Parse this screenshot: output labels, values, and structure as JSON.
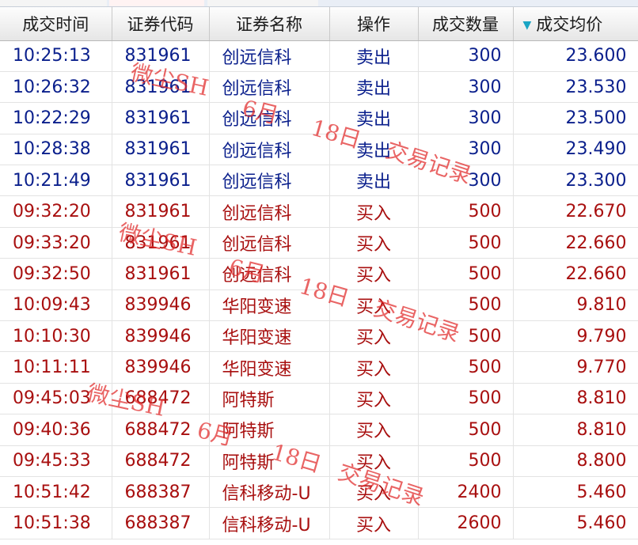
{
  "columns": [
    "成交时间",
    "证券代码",
    "证券名称",
    "操作",
    "成交数量",
    "成交均价"
  ],
  "sort_column": "成交均价",
  "rows": [
    {
      "time": "10:25:13",
      "code": "831961",
      "name": "创远信科",
      "op": "卖出",
      "qty": "300",
      "price": "23.600",
      "type": "sell"
    },
    {
      "time": "10:26:32",
      "code": "831961",
      "name": "创远信科",
      "op": "卖出",
      "qty": "300",
      "price": "23.530",
      "type": "sell"
    },
    {
      "time": "10:22:29",
      "code": "831961",
      "name": "创远信科",
      "op": "卖出",
      "qty": "300",
      "price": "23.500",
      "type": "sell"
    },
    {
      "time": "10:28:38",
      "code": "831961",
      "name": "创远信科",
      "op": "卖出",
      "qty": "300",
      "price": "23.490",
      "type": "sell"
    },
    {
      "time": "10:21:49",
      "code": "831961",
      "name": "创远信科",
      "op": "卖出",
      "qty": "300",
      "price": "23.300",
      "type": "sell"
    },
    {
      "time": "09:32:20",
      "code": "831961",
      "name": "创远信科",
      "op": "买入",
      "qty": "500",
      "price": "22.670",
      "type": "buy"
    },
    {
      "time": "09:33:20",
      "code": "831961",
      "name": "创远信科",
      "op": "买入",
      "qty": "500",
      "price": "22.660",
      "type": "buy"
    },
    {
      "time": "09:32:50",
      "code": "831961",
      "name": "创远信科",
      "op": "买入",
      "qty": "500",
      "price": "22.660",
      "type": "buy"
    },
    {
      "time": "10:09:43",
      "code": "839946",
      "name": "华阳变速",
      "op": "买入",
      "qty": "500",
      "price": "9.810",
      "type": "buy"
    },
    {
      "time": "10:10:30",
      "code": "839946",
      "name": "华阳变速",
      "op": "买入",
      "qty": "500",
      "price": "9.790",
      "type": "buy"
    },
    {
      "time": "10:11:11",
      "code": "839946",
      "name": "华阳变速",
      "op": "买入",
      "qty": "500",
      "price": "9.770",
      "type": "buy"
    },
    {
      "time": "09:45:03",
      "code": "688472",
      "name": "阿特斯",
      "op": "买入",
      "qty": "500",
      "price": "8.810",
      "type": "buy"
    },
    {
      "time": "09:40:36",
      "code": "688472",
      "name": "阿特斯",
      "op": "买入",
      "qty": "500",
      "price": "8.810",
      "type": "buy"
    },
    {
      "time": "09:45:33",
      "code": "688472",
      "name": "阿特斯",
      "op": "买入",
      "qty": "500",
      "price": "8.800",
      "type": "buy"
    },
    {
      "time": "10:51:42",
      "code": "688387",
      "name": "信科移动-U",
      "op": "买入",
      "qty": "2400",
      "price": "5.460",
      "type": "buy"
    },
    {
      "time": "10:51:38",
      "code": "688387",
      "name": "信科移动-U",
      "op": "买入",
      "qty": "2600",
      "price": "5.460",
      "type": "buy"
    }
  ],
  "watermarks": [
    "微尘SH",
    "6月",
    "18日",
    "交易记录"
  ],
  "colors": {
    "sell_text": "#0a1f8c",
    "buy_text": "#a80f0f",
    "sort_icon": "#1aa5c4",
    "watermark": "#e12828"
  }
}
